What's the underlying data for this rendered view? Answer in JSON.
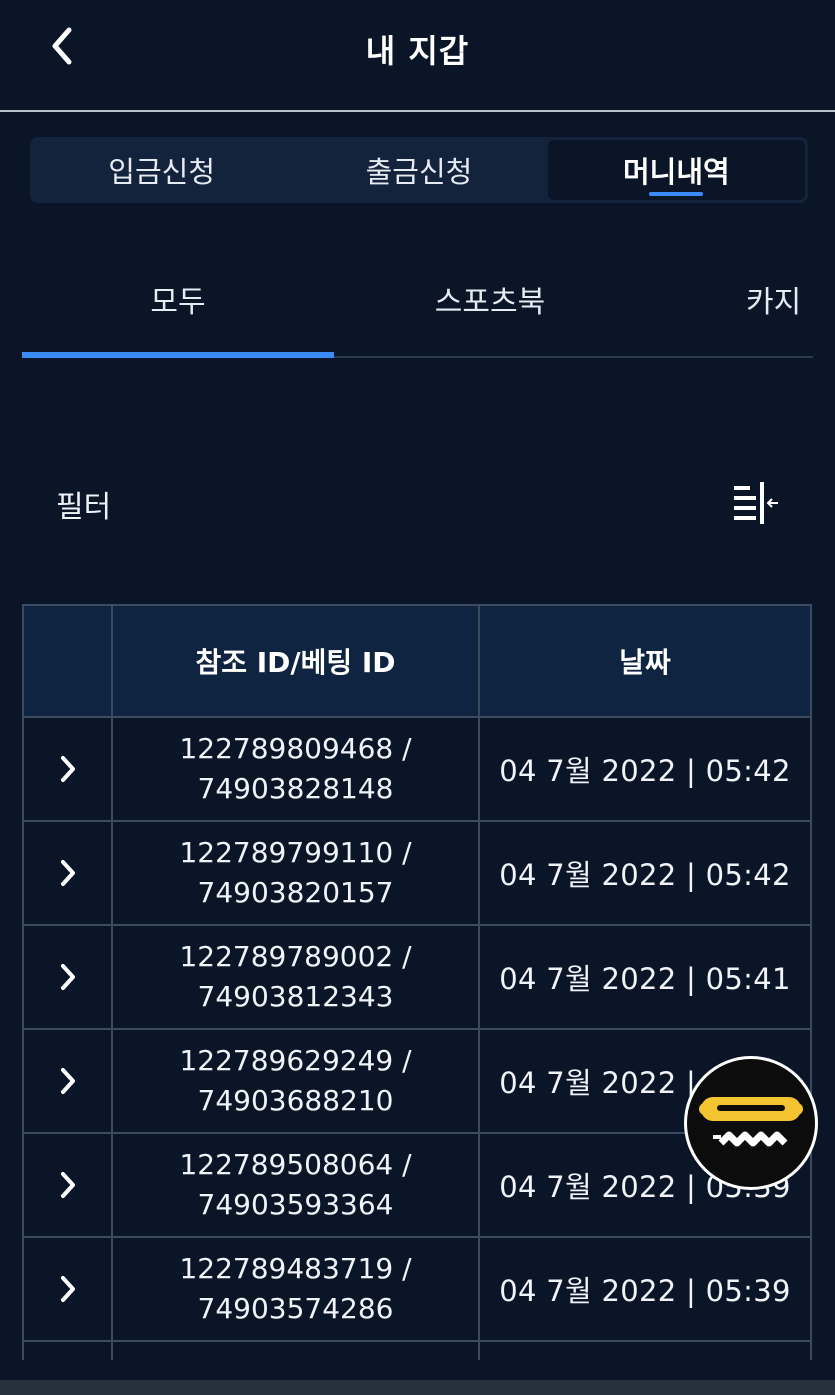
{
  "header": {
    "title": "내 지갑",
    "back_icon": "chevron-left-icon"
  },
  "segment_tabs": [
    {
      "label": "입금신청",
      "active": false
    },
    {
      "label": "출금신청",
      "active": false
    },
    {
      "label": "머니내역",
      "active": true
    }
  ],
  "sub_tabs": [
    {
      "label": "모두",
      "active": true
    },
    {
      "label": "스포츠북",
      "active": false
    },
    {
      "label": "카지",
      "active": false
    }
  ],
  "filter": {
    "label": "필터",
    "icon": "sort-filter-icon"
  },
  "table": {
    "headers": [
      "",
      "참조 ID/베팅 ID",
      "날짜"
    ],
    "rows": [
      {
        "ref_id": "122789809468 /",
        "bet_id": "74903828148",
        "date": "04 7월 2022 | 05:42"
      },
      {
        "ref_id": "122789799110 /",
        "bet_id": "74903820157",
        "date": "04 7월 2022 | 05:42"
      },
      {
        "ref_id": "122789789002 /",
        "bet_id": "74903812343",
        "date": "04 7월 2022 | 05:41"
      },
      {
        "ref_id": "122789629249 /",
        "bet_id": "74903688210",
        "date": "04 7월 2022 | 05:41"
      },
      {
        "ref_id": "122789508064 /",
        "bet_id": "74903593364",
        "date": "04 7월 2022 | 05:39"
      },
      {
        "ref_id": "122789483719 /",
        "bet_id": "74903574286",
        "date": "04 7월 2022 | 05:39"
      },
      {
        "ref_id": "",
        "bet_id": "",
        "date": ""
      }
    ]
  },
  "colors": {
    "background": "#0a1628",
    "accent": "#3a8af7",
    "table_header": "#0f2440",
    "fab_yellow": "#f5c431"
  }
}
